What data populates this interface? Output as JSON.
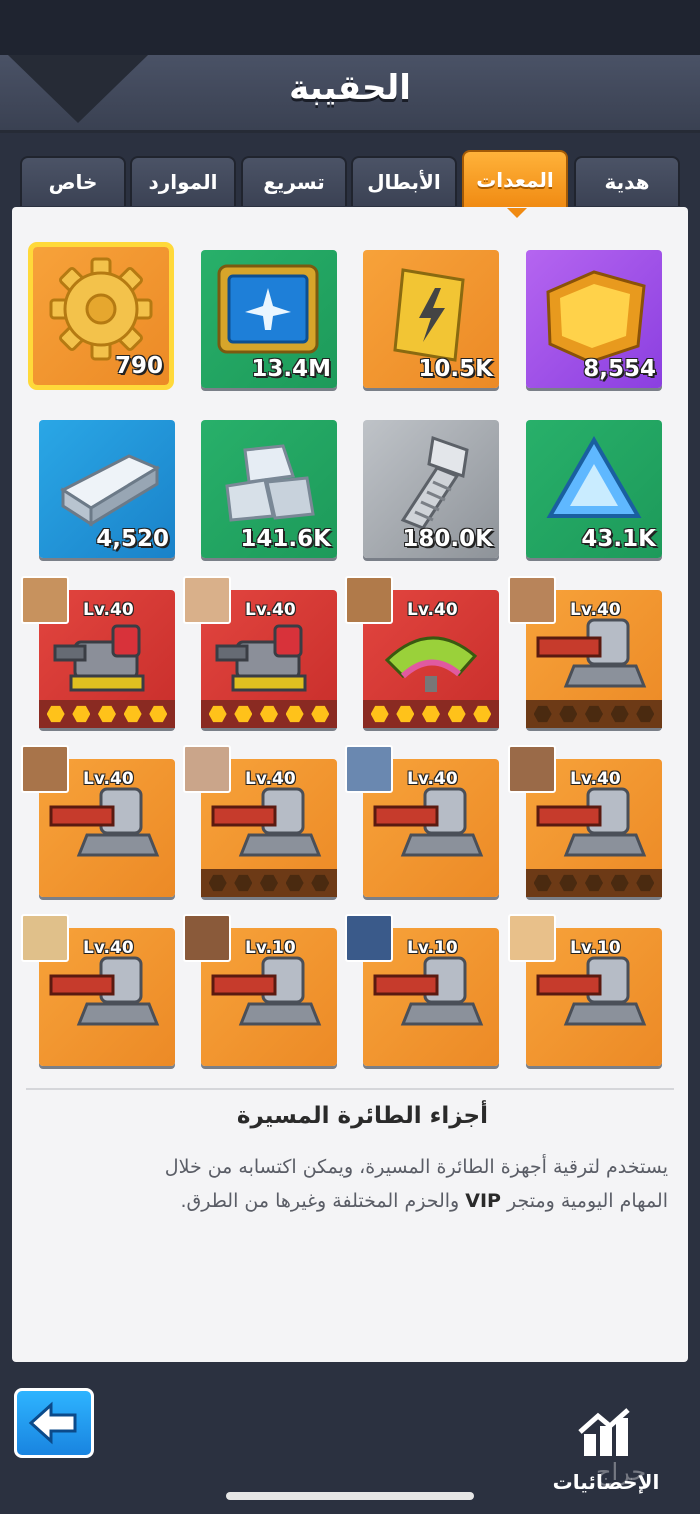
{
  "header": {
    "title": "الحقيبة"
  },
  "tabs": [
    {
      "label": "هدية"
    },
    {
      "label": "المعدات"
    },
    {
      "label": "الأبطال"
    },
    {
      "label": "تسريع"
    },
    {
      "label": "الموارد"
    },
    {
      "label": "خاص"
    }
  ],
  "active_tab": "المعدات",
  "resources": [
    {
      "qty": "8,554",
      "icon": "honeycomb-plate-icon"
    },
    {
      "qty": "10.5K",
      "icon": "lightning-chip-icon"
    },
    {
      "qty": "13.4M",
      "icon": "drone-blueprint-icon"
    },
    {
      "qty": "790",
      "icon": "golden-gear-icon"
    },
    {
      "qty": "43.1K",
      "icon": "blue-crystal-icon"
    },
    {
      "qty": "180.0K",
      "icon": "steel-bolt-icon"
    },
    {
      "qty": "141.6K",
      "icon": "metal-blocks-icon"
    },
    {
      "qty": "4,520",
      "icon": "steel-ingot-icon"
    }
  ],
  "equipment": [
    {
      "level": "Lv.40"
    },
    {
      "level": "Lv.40"
    },
    {
      "level": "Lv.40"
    },
    {
      "level": "Lv.40"
    },
    {
      "level": "Lv.40"
    },
    {
      "level": "Lv.40"
    },
    {
      "level": "Lv.40"
    },
    {
      "level": "Lv.40"
    },
    {
      "level": "Lv.10"
    },
    {
      "level": "Lv.10"
    },
    {
      "level": "Lv.10"
    },
    {
      "level": "Lv.40"
    }
  ],
  "description": {
    "title": "أجزاء الطائرة المسيرة",
    "line1": "يستخدم لترقية أجهزة الطائرة المسيرة، ويمكن اكتسابه من خلال",
    "line2_a": "المهام اليومية ومتجر",
    "line2_vip": "VIP",
    "line2_b": "والحزم المختلفة وغيرها من الطرق."
  },
  "footer": {
    "stats_label": "الإحصائيات",
    "watermark": "حراج"
  },
  "colors": {
    "accent": "#f08a12",
    "selected": "#ffd93a",
    "panel": "#f4f4f6"
  }
}
